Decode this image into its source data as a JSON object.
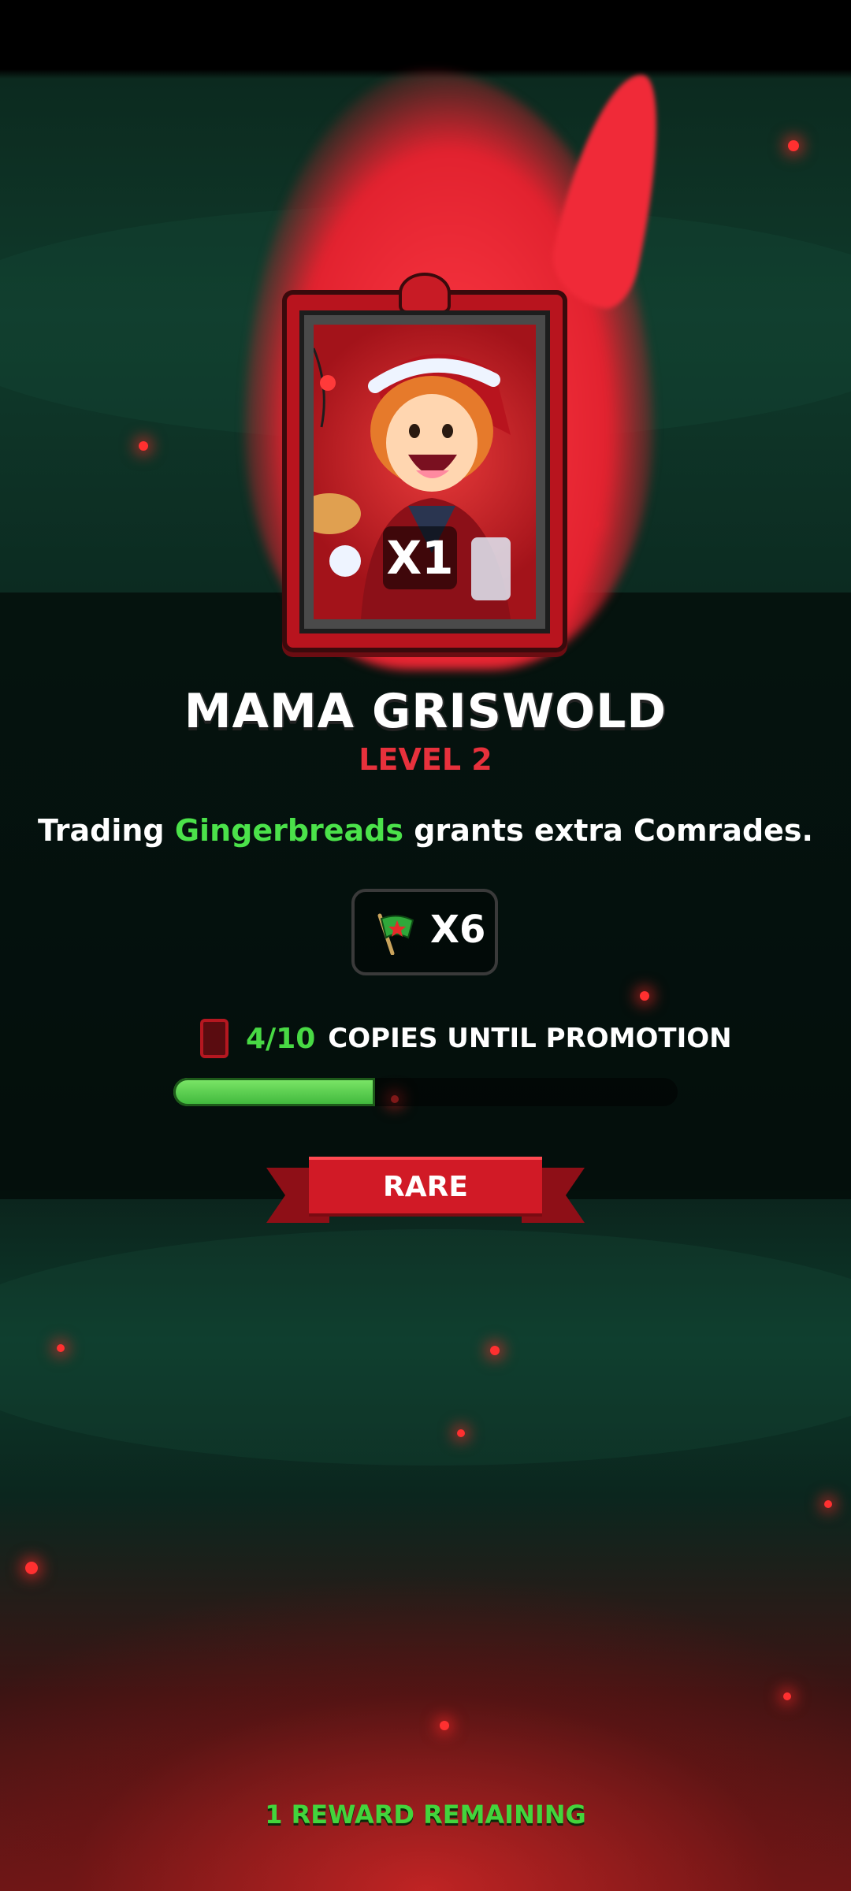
{
  "card": {
    "name": "MAMA GRISWOLD",
    "level": "LEVEL 2",
    "count": "X1",
    "rarity": "RARE"
  },
  "description": {
    "before": "Trading ",
    "highlight": "Gingerbreads",
    "after": " grants extra Comrades."
  },
  "reward": {
    "icon": "flag-icon",
    "quantity": "X6"
  },
  "promotion": {
    "progress_text": "4/10",
    "label": "COPIES UNTIL PROMOTION",
    "progress_fraction": 0.4
  },
  "footer": {
    "remaining": "1 REWARD REMAINING"
  },
  "colors": {
    "accent_red": "#e7313c",
    "accent_green": "#4be24a",
    "background_green": "#0f3a2b"
  }
}
